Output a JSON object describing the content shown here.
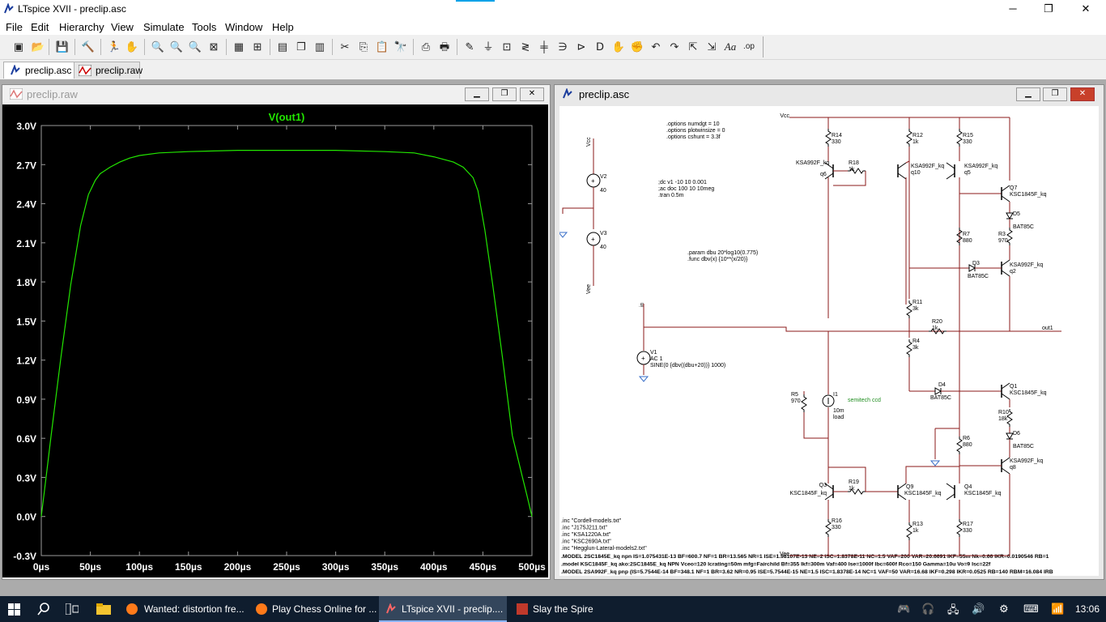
{
  "app": {
    "title": "LTspice XVII - preclip.asc",
    "minimize": "─",
    "maximize": "❐",
    "close": "✕"
  },
  "menu": [
    "File",
    "Edit",
    "Hierarchy",
    "View",
    "Simulate",
    "Tools",
    "Window",
    "Help"
  ],
  "tabs": [
    {
      "label": "preclip.asc",
      "icon": "schematic-icon"
    },
    {
      "label": "preclip.raw",
      "icon": "waveform-icon"
    }
  ],
  "plot_window": {
    "title": "preclip.raw",
    "trace_label": "V(out1)",
    "trace_color": "#22e600"
  },
  "chart_data": {
    "type": "line",
    "title": "V(out1)",
    "y_ticks": [
      "3.0V",
      "2.7V",
      "2.4V",
      "2.1V",
      "1.8V",
      "1.5V",
      "1.2V",
      "0.9V",
      "0.6V",
      "0.3V",
      "0.0V",
      "-0.3V"
    ],
    "x_ticks": [
      "0µs",
      "50µs",
      "100µs",
      "150µs",
      "200µs",
      "250µs",
      "300µs",
      "350µs",
      "400µs",
      "450µs",
      "500µs"
    ],
    "xlim": [
      0,
      500
    ],
    "ylim": [
      -0.3,
      3.0
    ],
    "series": [
      {
        "color": "#22e600",
        "x": [
          0,
          5,
          10,
          20,
          30,
          40,
          48,
          55,
          60,
          70,
          80,
          90,
          100,
          120,
          150,
          200,
          250,
          300,
          350,
          380,
          400,
          420,
          430,
          440,
          445,
          452,
          460,
          470,
          480,
          490,
          495,
          500
        ],
        "y": [
          0.0,
          0.31,
          0.62,
          1.22,
          1.78,
          2.23,
          2.47,
          2.58,
          2.63,
          2.68,
          2.72,
          2.75,
          2.77,
          2.79,
          2.8,
          2.81,
          2.81,
          2.81,
          2.8,
          2.79,
          2.76,
          2.72,
          2.68,
          2.6,
          2.5,
          2.2,
          1.78,
          1.22,
          0.62,
          0.31,
          0.16,
          0.0
        ]
      }
    ]
  },
  "schem_window": {
    "title": "preclip.asc"
  },
  "schematic": {
    "options": [
      ".options numdgt = 10",
      ".options plotwinsize = 0",
      ".options cshunt = 3.3f"
    ],
    "analysis": [
      ";dc v1 -10 10 0.001",
      ";ac doc 100 10 10meg",
      ".tran 0.5m"
    ],
    "params": [
      ".param dbu 20*log10(0.775)",
      ".func dbv(x) {10**(x/20)}"
    ],
    "includes": [
      ".inc \"Cordell-models.txt\"",
      ".inc \"J175J211.txt\"",
      ".inc \"KSA1220A.txt\"",
      ".inc \"KSC2690A.txt\"",
      ".inc \"Hegglun-Lateral-models2.txt\""
    ],
    "models": [
      ".MODEL 2SC1845E_kq npn IS=1.075431E-13 BF=600.7 NF=1 BR=13.565 NR=1 ISE=1.98107E-13 NE=2 ISC=1.8378E-11 NC=1.5 VAF=200 VAR=20.6691 IKF=55m Nk=0.66 IKR=0.0190546 RB=1",
      ".model KSC1845F_kq ako:2SC1845E_kq NPN Vceo=120 Icrating=50m mfg=Fairchild Bf=355 Ikf=300m Vaf=400 Ise=1000f Ibc=600f Rco=150 Gamma=10u Vo=9 Isc=22f",
      ".MODEL 2SA992F_kq pnp (IS=5.7544E-14 BF=348.1 NF=1 BR=3.62 NR=0.95 ISE=5.7544E-15 NE=1.5 ISC=1.8378E-14 NC=1 VAF=50 VAR=16.68 IKF=0.298 IKR=0.0525 RB=140 RBM=16.084 IRB"
    ],
    "v1": {
      "name": "V1",
      "ac": "AC 1",
      "value": "SINE(0 {dbv((dbu+20))} 1000)"
    },
    "v2": {
      "name": "V2",
      "value": "40"
    },
    "v3": {
      "name": "V3",
      "value": "40"
    },
    "vcc": "Vcc",
    "vee": "Vee",
    "in_label": "in",
    "out_label": "out1",
    "i1": {
      "name": "I1",
      "value": "10m",
      "note": "load"
    },
    "green_note": "semitech ccd",
    "green_color": "#1e8c1e",
    "parts": [
      {
        "ref": "R14",
        "val": "330"
      },
      {
        "ref": "R12",
        "val": "1k"
      },
      {
        "ref": "R15",
        "val": "330"
      },
      {
        "ref": "R18",
        "val": "1k"
      },
      {
        "ref": "R7",
        "val": "880"
      },
      {
        "ref": "R3",
        "val": "970"
      },
      {
        "ref": "R11",
        "val": "3k"
      },
      {
        "ref": "R20",
        "val": "1k"
      },
      {
        "ref": "R4",
        "val": "3k"
      },
      {
        "ref": "R10",
        "val": "18k"
      },
      {
        "ref": "R5",
        "val": "970"
      },
      {
        "ref": "R6",
        "val": "880"
      },
      {
        "ref": "R19",
        "val": "1k"
      },
      {
        "ref": "R16",
        "val": "330"
      },
      {
        "ref": "R13",
        "val": "1k"
      },
      {
        "ref": "R17",
        "val": "330"
      }
    ],
    "transistors": [
      {
        "ref": "q6",
        "model": "KSA992F_kq"
      },
      {
        "ref": "q10",
        "model": "KSA992F_kq"
      },
      {
        "ref": "q5",
        "model": "KSA992F_kq"
      },
      {
        "ref": "Q7",
        "model": "KSC1845F_kq"
      },
      {
        "ref": "q2",
        "model": "KSA992F_kq"
      },
      {
        "ref": "Q1",
        "model": "KSC1845F_kq"
      },
      {
        "ref": "q8",
        "model": "KSA992F_kq"
      },
      {
        "ref": "Q3",
        "model": "KSC1845F_kq"
      },
      {
        "ref": "Q9",
        "model": "KSC1845F_kq"
      },
      {
        "ref": "Q4",
        "model": "KSC1845F_kq"
      }
    ],
    "diodes": [
      {
        "ref": "D5",
        "model": "BAT85C"
      },
      {
        "ref": "D3",
        "model": "BAT85C"
      },
      {
        "ref": "D4",
        "model": "BAT85C"
      },
      {
        "ref": "D6",
        "model": "BAT85C"
      }
    ],
    "wire_color": "#8b1a1a"
  },
  "taskbar": {
    "items": [
      {
        "label": "Wanted: distortion fre...",
        "icon": "firefox-icon"
      },
      {
        "label": "Play Chess Online for ...",
        "icon": "firefox-icon"
      },
      {
        "label": "LTspice XVII - preclip....",
        "icon": "ltspice-icon"
      },
      {
        "label": "Slay the Spire",
        "icon": "game-icon"
      }
    ],
    "time": "13:06"
  }
}
